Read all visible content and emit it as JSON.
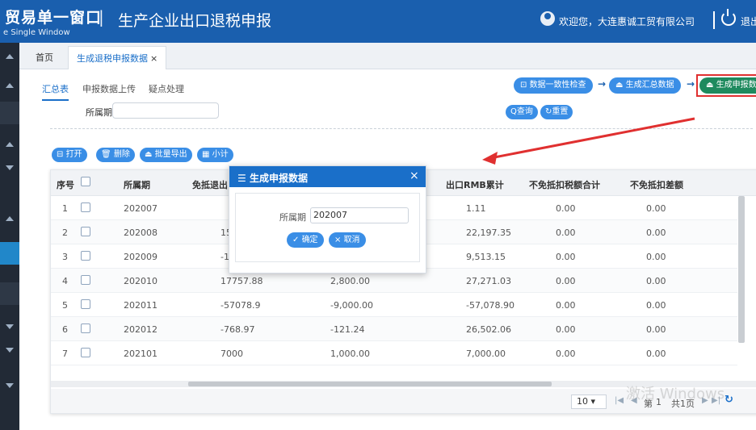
{
  "header": {
    "brand": "贸易单一窗口",
    "brand_sub": "e Single Window",
    "divider": "|",
    "title": "生产企业出口退税申报",
    "welcome": "欢迎您，大连惠诚工贸有限公司",
    "logout": "退出"
  },
  "tabs": {
    "home": "首页",
    "active": "生成退税申报数据",
    "close": "×"
  },
  "subtabs": [
    "汇总表",
    "申报数据上传",
    "疑点处理"
  ],
  "steps": {
    "check": "数据一致性检查",
    "summary": "生成汇总数据",
    "generate": "生成申报数据",
    "arrow": "→"
  },
  "filter": {
    "label": "所属期",
    "query": "查询",
    "reset": "重置"
  },
  "toolbar": {
    "open": "打开",
    "delete": "删除",
    "export": "批量导出",
    "subtotal": "小计"
  },
  "table": {
    "headers": [
      "序号",
      "所属期",
      "免抵退出口",
      "出口RMB累计",
      "不免抵扣税额合计",
      "不免抵扣差额"
    ],
    "rows": [
      {
        "no": "1",
        "period": "202007",
        "free": "",
        "mid": "",
        "rmb": "1.11",
        "tax": "0.00",
        "diff": "0.00"
      },
      {
        "no": "2",
        "period": "202008",
        "free": "15",
        "mid": "",
        "rmb": "22,197.35",
        "tax": "0.00",
        "diff": "0.00"
      },
      {
        "no": "3",
        "period": "202009",
        "free": "-1",
        "mid": "",
        "rmb": "9,513.15",
        "tax": "0.00",
        "diff": "0.00"
      },
      {
        "no": "4",
        "period": "202010",
        "free": "17757.88",
        "mid": "2,800.00",
        "rmb": "27,271.03",
        "tax": "0.00",
        "diff": "0.00"
      },
      {
        "no": "5",
        "period": "202011",
        "free": "-57078.9",
        "mid": "-9,000.00",
        "rmb": "-57,078.90",
        "tax": "0.00",
        "diff": "0.00"
      },
      {
        "no": "6",
        "period": "202012",
        "free": "-768.97",
        "mid": "-121.24",
        "rmb": "26,502.06",
        "tax": "0.00",
        "diff": "0.00"
      },
      {
        "no": "7",
        "period": "202101",
        "free": "7000",
        "mid": "1,000.00",
        "rmb": "7,000.00",
        "tax": "0.00",
        "diff": "0.00"
      }
    ]
  },
  "pager": {
    "size": "10",
    "page_label": "第",
    "page": "1",
    "total": "共1页",
    "watermark": "激活 Windows"
  },
  "modal": {
    "title": "生成申报数据",
    "close": "×",
    "label": "所属期",
    "value": "202007",
    "ok": "确定",
    "cancel": "取消"
  },
  "colors": {
    "header_bg": "#1a5fae",
    "accent": "#1a6fc9",
    "button_blue": "#3a8ee6",
    "button_green": "#1e8a5e",
    "annotation_red": "#e03030"
  }
}
